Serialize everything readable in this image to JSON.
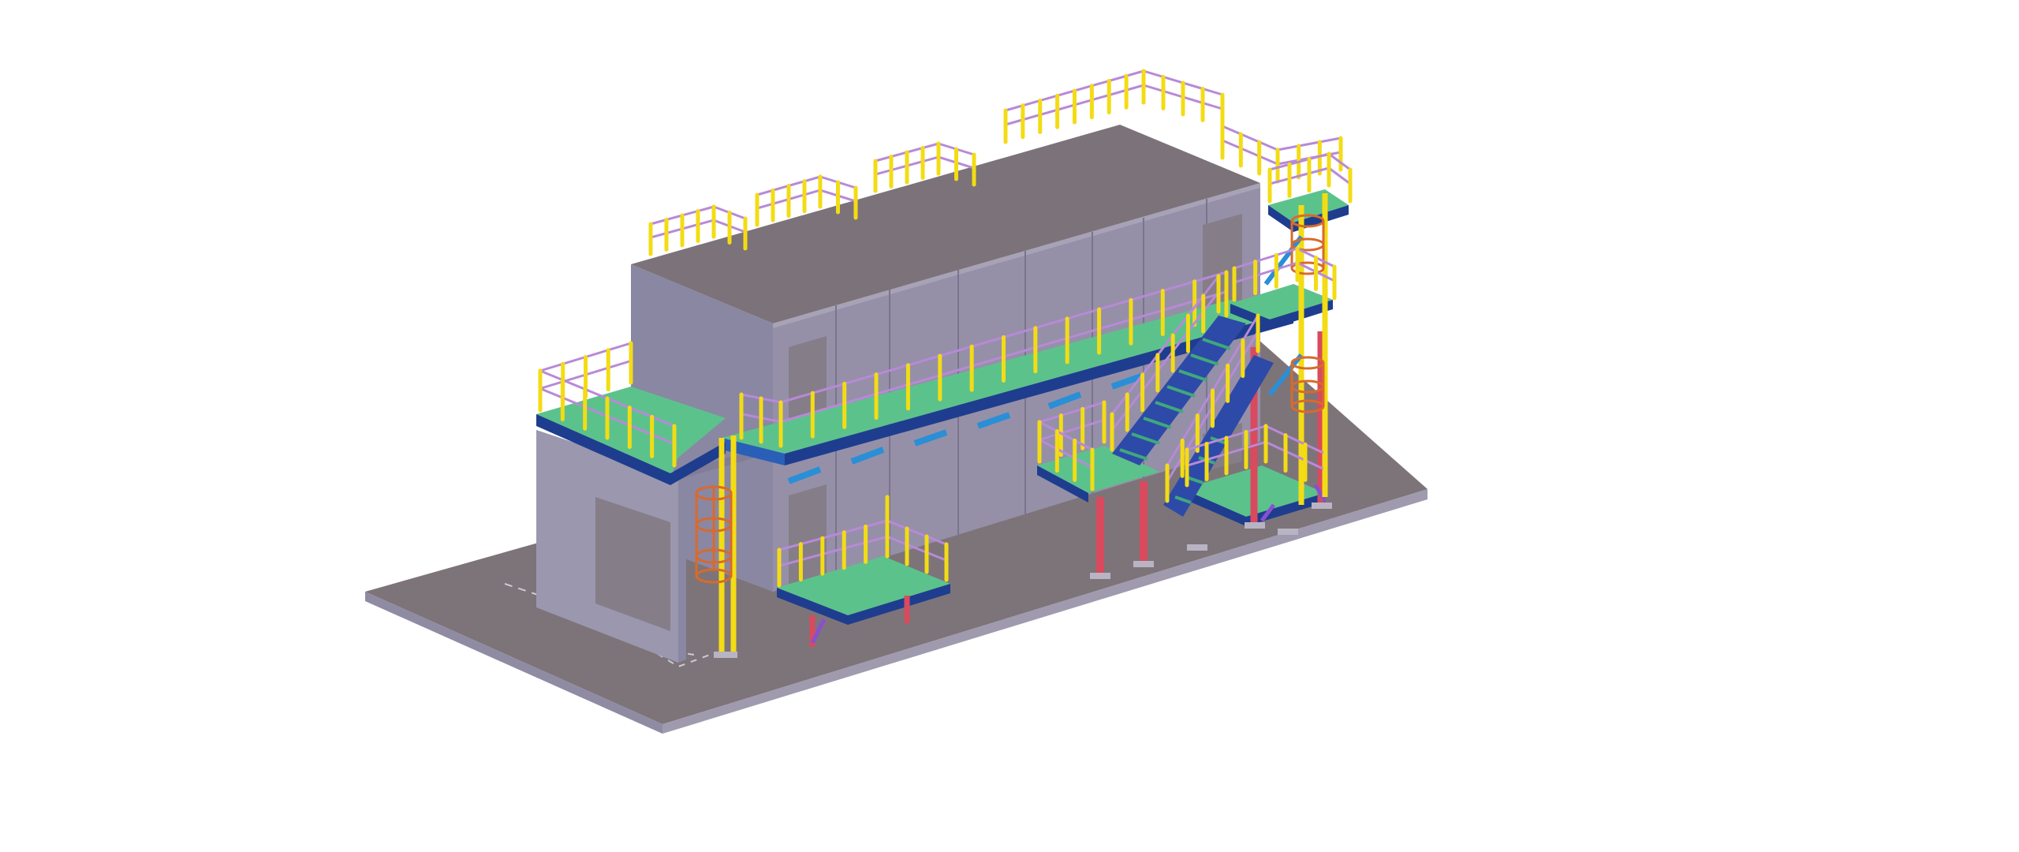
{
  "viewer": {
    "background": "#ffffff"
  },
  "colors": {
    "concrete_top": "#7d7479",
    "concrete_side": "#9f9aad",
    "concrete_front": "#8f8ba3",
    "building_roof": "#7b7379",
    "building_wall_front": "#9590a8",
    "building_wall_side": "#8a87a3",
    "building_wall_low": "#9a97ae",
    "door": "#857e88",
    "panel_line": "#7f7a92",
    "grating": "#5cc28c",
    "grating_dark": "#3da77a",
    "beam": "#1e3d8f",
    "beam_light": "#2a5fb8",
    "bracket": "#2a8fd6",
    "post": "#f3dc14",
    "rail": "#b889d8",
    "column": "#d94a5e",
    "cage": "#d86a2c",
    "brace": "#8a4fd0",
    "stair": "#2d4aa8"
  },
  "model": {
    "components": [
      "foundation-slab",
      "building-block",
      "upper-walkway",
      "lower-left-platform",
      "lower-platform",
      "stair-flight",
      "right-tower",
      "roof-guardrails",
      "caged-ladder-left",
      "caged-ladder-right"
    ]
  }
}
